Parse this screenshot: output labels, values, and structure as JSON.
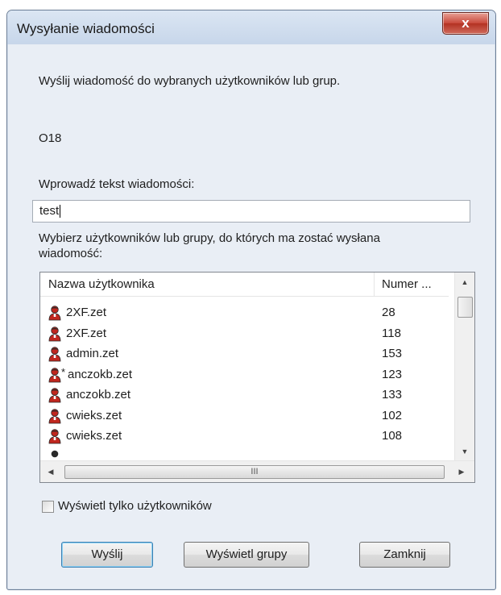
{
  "window": {
    "title": "Wysyłanie wiadomości",
    "close_label": "x"
  },
  "intro_text": "Wyślij wiadomość do wybranych użytkowników lub grup.",
  "sender_label": "O18",
  "message_label": "Wprowadź tekst wiadomości:",
  "message_value": "test",
  "recipients_label_line1": "Wybierz użytkowników lub grupy, do których ma zostać wysłana",
  "recipients_label_line2": "wiadomość:",
  "list": {
    "columns": [
      "Nazwa użytkownika",
      "Numer ..."
    ],
    "rows": [
      {
        "name": "2XF.zet",
        "number": "28",
        "marked": false
      },
      {
        "name": "2XF.zet",
        "number": "118",
        "marked": false
      },
      {
        "name": "admin.zet",
        "number": "153",
        "marked": false
      },
      {
        "name": "anczokb.zet",
        "number": "123",
        "marked": true
      },
      {
        "name": "anczokb.zet",
        "number": "133",
        "marked": false
      },
      {
        "name": "cwieks.zet",
        "number": "102",
        "marked": false
      },
      {
        "name": "cwieks.zet",
        "number": "108",
        "marked": false
      }
    ],
    "hscroll_grip": "III"
  },
  "checkbox": {
    "label": "Wyświetl tylko użytkowników",
    "checked": false
  },
  "buttons": {
    "send": "Wyślij",
    "show_groups": "Wyświetl grupy",
    "close": "Zamknij"
  },
  "colors": {
    "icon_red": "#c0271e",
    "icon_dark": "#2a2a2a",
    "title_bar": "#cbd9eb"
  }
}
